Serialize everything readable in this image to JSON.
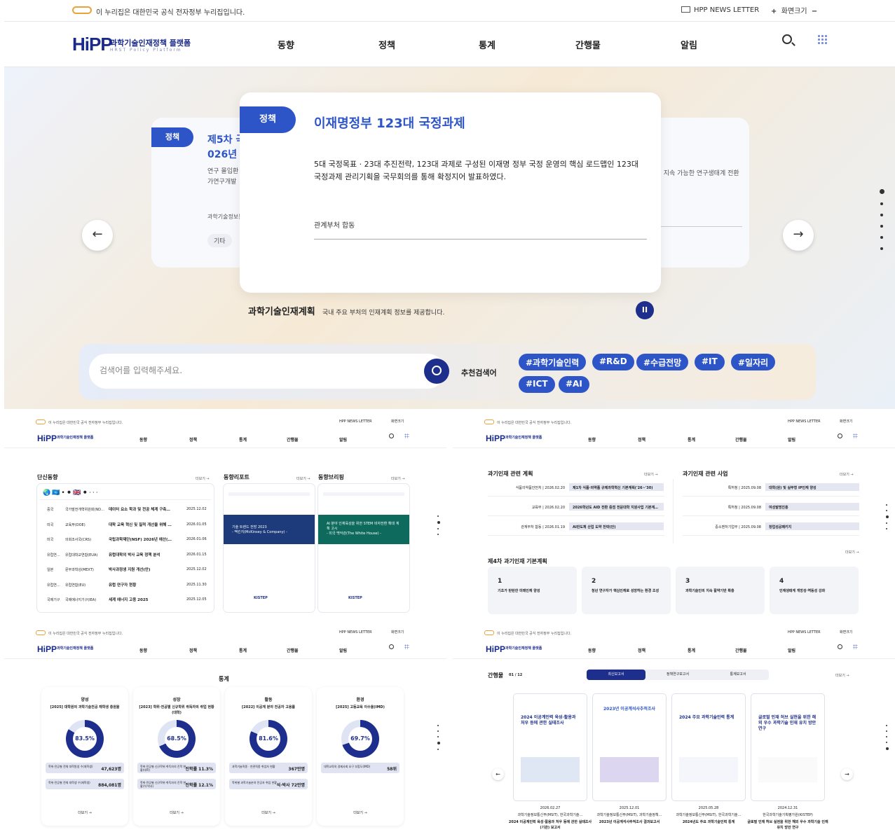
{
  "gov_bar": {
    "notice": "이 누리집은 대한민국 공식 전자정부 누리집입니다.",
    "newsletter": "HPP NEWS LETTER",
    "zoom": "화면크기",
    "plus": "+",
    "minus": "−"
  },
  "brand": {
    "logo": "HiPP",
    "title": "과학기술인재정책 플랫폼",
    "subtitle": "HRST Policy Platform"
  },
  "nav": [
    "동향",
    "정책",
    "통계",
    "간행물",
    "알림"
  ],
  "hero": {
    "tag": "정책",
    "title": "이재명정부 123대 국정과제",
    "desc": "5대 국정목표 · 23대 추진전략, 123대 과제로 구성된 이재명 정부 국정 운영의 핵심 로드맵인 123대 국정과제 관리기획을 국무회의를 통해 확정지어 발표하였다.",
    "org": "관계부처 합동",
    "left_tag": "정책",
    "left_title_1": "제5차 국",
    "left_title_2": "026년 ~",
    "left_desc_1": "연구 몰입환",
    "left_desc_2": "가연구개발 ",
    "left_org": "과학기술정보통",
    "left_chip": "기타",
    "right_desc": ", 지속 가능한 연구생태계 전환",
    "prev": "←",
    "next": "→",
    "caption_title": "과학기술인재계획",
    "caption_text": "국내 주요 부처의 인재계획 정보를 제공합니다.",
    "pause": "II"
  },
  "search": {
    "placeholder": "검색어를 입력해주세요.",
    "rec_label": "추천검색어",
    "keywords": [
      "#과학기술인력",
      "#R&D",
      "#수급전망",
      "#IT",
      "#일자리",
      "#ICT",
      "#AI"
    ]
  },
  "trends": {
    "brief_title": "단신동향",
    "more": "더보기 →",
    "report_title": "동향리포트",
    "briefing_title": "동향브리핑",
    "rows": [
      {
        "c": "중국",
        "o": "국가발전개혁위원회(ND…",
        "t": "데이터 요소 학과 및 전공 체계 구축…",
        "d": "2025.12.02"
      },
      {
        "c": "미국",
        "o": "교육부(DOE)",
        "t": "대학 교육 혁신 및 질적 개선을 위해 …",
        "d": "2026.01.05"
      },
      {
        "c": "미국",
        "o": "의회조사국(CRS)",
        "t": "국립과학재단(NSF) 2026년 예산(…",
        "d": "2026.01.06"
      },
      {
        "c": "유럽연…",
        "o": "유럽대학교연합(EUA)",
        "t": "유럽대학의 박사 교육 정책 분석",
        "d": "2026.01.15"
      },
      {
        "c": "일본",
        "o": "문부과학성(MEXT)",
        "t": "박사과정생 지원 개선(안)",
        "d": "2025.12.02"
      },
      {
        "c": "유럽연…",
        "o": "유럽연합(EU)",
        "t": "유럽 연구자 현황",
        "d": "2025.11.30"
      },
      {
        "c": "국제기구",
        "o": "국제에너지기구(IEA)",
        "t": "세계 에너지 고용 2025",
        "d": "2025.12.05"
      }
    ],
    "report_cover": "기술 트렌드 전망 2023",
    "report_sub": "- 맥킨지(McKinsey & Company) -",
    "briefing_cover": "AI 분야 인재육성을 위한 STEM 비자전환 확대 계획 고시",
    "briefing_sub": "- 미국 백악관(The White House) -",
    "publisher": "KISTEP"
  },
  "policy": {
    "plan_title": "과기인재 관련 계획",
    "biz_title": "과기인재 관련 사업",
    "basic_title": "제4차 과기인재 기본계획",
    "more": "더보기 →",
    "plans": [
      {
        "o": "식품의약품안전처 | 2026.02.20",
        "t": "제1차 식품·의약품 규제과학혁신 기본계획('26~'30)"
      },
      {
        "o": "교육부 | 2026.02.20",
        "t": "2026학년도 AID 전환 중점 전문대학 지원사업 기본계…"
      },
      {
        "o": "관계부처 합동 | 2026.01.19",
        "t": "AI반도체 산업 도약 전략(안)"
      }
    ],
    "biz": [
      {
        "o": "특허청 | 2025.09.08",
        "t": "대학(원) 및 실무형 IP인재 양성"
      },
      {
        "o": "특허청 | 2025.09.08",
        "t": "여성발명진흥"
      },
      {
        "o": "중소벤처기업부 | 2025.09.08",
        "t": "창업성공패키지"
      }
    ],
    "basic": [
      {
        "n": "1",
        "t": "기초가 탄탄한 미래인재 양성"
      },
      {
        "n": "2",
        "t": "청년 연구자가 핵심인재로 성장하는 환경 조성"
      },
      {
        "n": "3",
        "t": "과학기술인의 지속 활약기반 확충"
      },
      {
        "n": "4",
        "t": "인재생태계 개방성·역동성 강화"
      }
    ]
  },
  "stats": {
    "title": "통계",
    "more": "더보기 →",
    "cards": [
      {
        "cat": "양성",
        "name": "[2025] 대학원의 과학기술전공 재학생 충원율",
        "pct": "83.5%",
        "val": 83.5,
        "b1": "학위·전공별 전체 대학원생 수(재학생)",
        "v1": "47,623명",
        "b2": "학위·전공별 전체 대학생 수(재학생)",
        "v2": "884,081명"
      },
      {
        "cat": "성장",
        "name": "[2023] 학위·전공별 신규학위 취득자의 취업 현황(대학)",
        "pct": "68.5%",
        "val": 68.5,
        "b1": "학위·전공별 신규학위 취득자의 진학 현황(대학)",
        "v1": "진학률 11.3%",
        "b2": "학위·전공별 신규학위 취득자의 진학 현황(석·박사)",
        "v2": "진학률 12.1%"
      },
      {
        "cat": "활동",
        "name": "[2022] 이공계 분야 전공자 고용률",
        "pct": "81.6%",
        "val": 81.6,
        "b1": "과학기술직종 · 연관직종 취업자 현황",
        "v1": "367만명",
        "b2": "학위별 과학기술분야 전공자 취업 현황",
        "v2": "석·박사 72만명"
      },
      {
        "cat": "환경",
        "name": "[2025] 고등교육 이수율(IMD)",
        "pct": "69.7%",
        "val": 69.7,
        "b1": "대학교육의 경제사회 요구 부합도(IMD)",
        "v1": "58위",
        "b2": "",
        "v2": ""
      }
    ]
  },
  "pubs": {
    "title": "간행물",
    "count": "01 / 12",
    "more": "더보기 →",
    "tabs": [
      "최신보고서",
      "정책연구보고서",
      "통계보고서"
    ],
    "items": [
      {
        "cover": "2024 이공계인력 육성·활용과 처우 등에 관한 실태조사",
        "date": "2026.02.27",
        "org": "과학기술정보통신부(MSIT), 한국과학기술…",
        "name": "2024 이공계인력 육성·활용과 처우 등에 관한 실태조사(기관) 보고서"
      },
      {
        "cover": "2023년 이공계석사추적조사",
        "date": "2025.12.01",
        "org": "과학기술정보통신부(MSIT), 과학기술정책…",
        "name": "2023년 이공계석사추적조사 결과보고서"
      },
      {
        "cover": "2024 주요 과학기술인력 통계",
        "date": "2025.05.28",
        "org": "과학기술정보통신부(MSIT), 한국과학기술…",
        "name": "2024년도 주요 과학기술인력 통계"
      },
      {
        "cover": "글로벌 인재 허브 실현을 위한 해외 우수 과학기술 인재 유치 방안 연구",
        "date": "2024.12.31",
        "org": "한국과학기술기획평가원(KISTEP)",
        "name": "글로벌 인재 허브 실현을 위한 해외 우수 과학기술 인재 유치 방안 연구"
      }
    ]
  },
  "colors": {
    "primary": "#1d2e8c",
    "accent": "#2d55c8",
    "brand_red": "#e53935",
    "donut_track": "#dfe4f5"
  }
}
